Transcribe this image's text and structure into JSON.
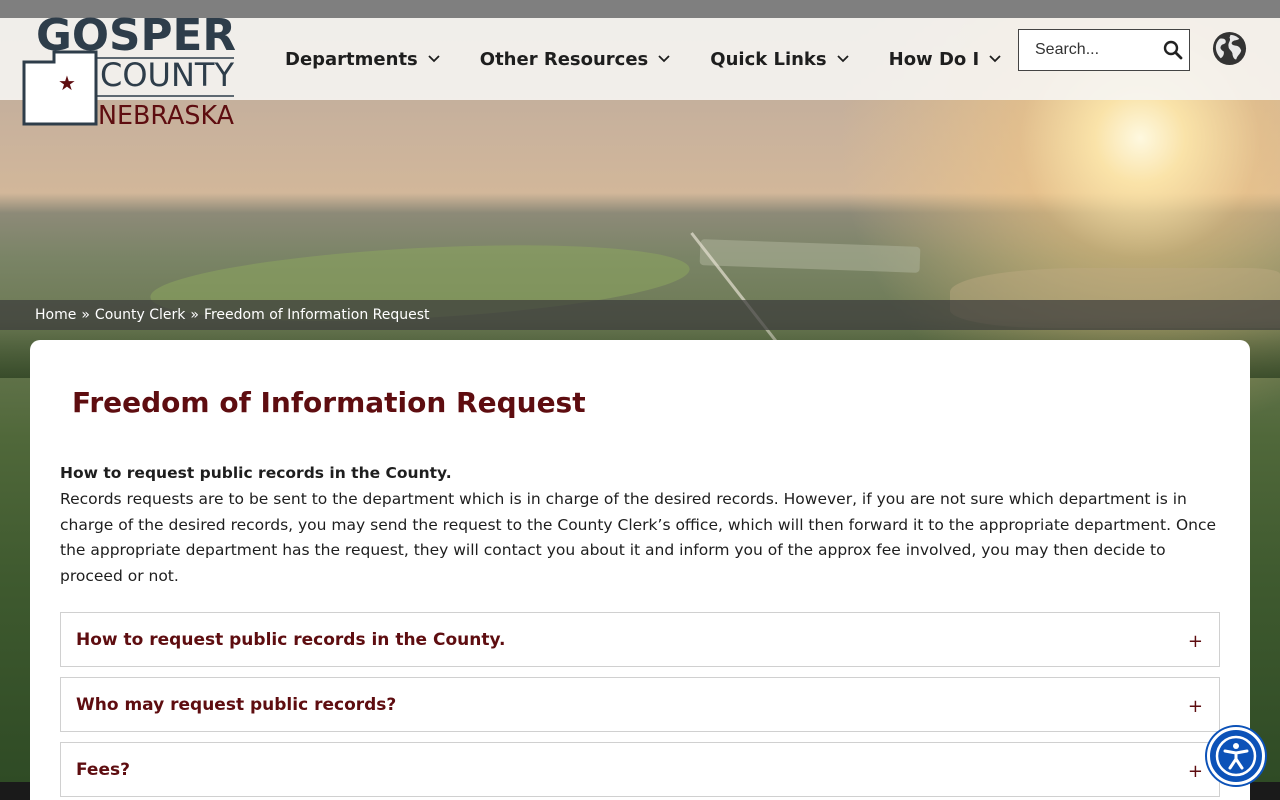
{
  "logo": {
    "line1": "GOSPER",
    "line2": "COUNTY",
    "line3": "NEBRASKA"
  },
  "nav": {
    "items": [
      {
        "label": "Departments"
      },
      {
        "label": "Other Resources"
      },
      {
        "label": "Quick Links"
      },
      {
        "label": "How Do I"
      }
    ]
  },
  "search": {
    "placeholder": "Search..."
  },
  "breadcrumb": {
    "home": "Home",
    "separator": "»",
    "parent": "County Clerk",
    "current": "Freedom of Information Request"
  },
  "main": {
    "title": "Freedom of Information Request",
    "intro_heading": "How to request public records in the County.",
    "intro_body": "Records requests are to be sent to the department which is in charge of the desired records. However, if you are not sure which department is in charge of the desired records, you may send the request to the County Clerk’s office, which will then forward it to the appropriate department. Once the appropriate department has the request, they will contact you about it and inform you of the approx fee involved, you may then decide to proceed or not.",
    "accordion": [
      {
        "title": "How to request public records in the County.",
        "toggle": "+"
      },
      {
        "title": "Who may request public records?",
        "toggle": "+"
      },
      {
        "title": "Fees?",
        "toggle": "+"
      }
    ]
  },
  "colors": {
    "brand_maroon": "#5e0d10",
    "logo_slate": "#2e3d4a",
    "accessibility_blue": "#0c52b8"
  },
  "icons": {
    "nav_chevron": "chevron-down-icon",
    "search": "search-icon",
    "language": "globe-icon",
    "accessibility": "accessibility-icon",
    "accordion_toggle": "plus-icon"
  }
}
